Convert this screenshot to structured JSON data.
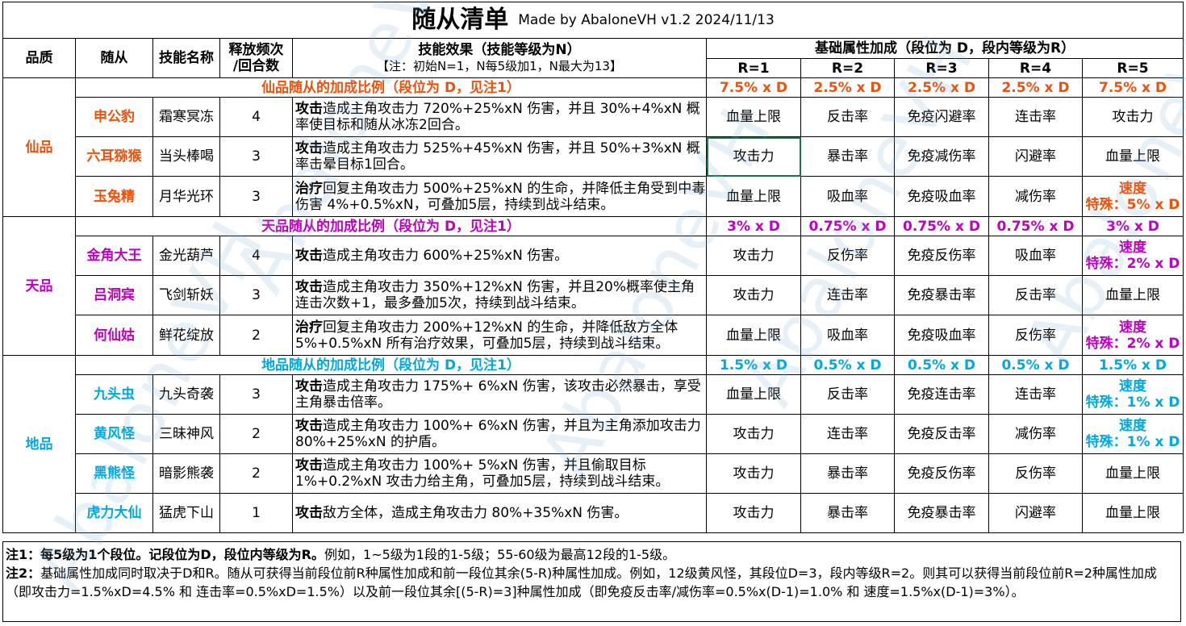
{
  "title": {
    "main": "随从清单",
    "sub": "Made by AbaloneVH  v1.2  2024/11/13"
  },
  "headers": {
    "quality": "品质",
    "follower": "随从",
    "skill_name": "技能名称",
    "freq_line1": "释放频次",
    "freq_line2": "/回合数",
    "effect_line1": "技能效果（技能等级为N）",
    "effect_line2": "【注：初始N=1，N每5级加1，N最大为13】",
    "attr_group": "基础属性加成（段位为 D，段内等级为R）",
    "r_labels": [
      "R=1",
      "R=2",
      "R=3",
      "R=4",
      "R=5"
    ]
  },
  "tiers": [
    {
      "quality": "仙品",
      "ratio_label": "仙品随从的加成比例（段位为 D，见注1）",
      "ratios": [
        "7.5% x D",
        "2.5% x D",
        "2.5% x D",
        "2.5% x D",
        "7.5% x D"
      ],
      "followers": [
        {
          "name": "申公豹",
          "skill": "霜寒冥冻",
          "freq": "4",
          "effect_bold": "攻击",
          "effect_rest": "造成主角攻击力 720%+25%xN 伤害，并且 30%+4%xN 概率使目标和随从冰冻2回合。",
          "attrs": [
            "血量上限",
            "反击率",
            "免疫闪避率",
            "连击率",
            "攻击力"
          ]
        },
        {
          "name": "六耳猕猴",
          "skill": "当头棒喝",
          "freq": "3",
          "effect_bold": "攻击",
          "effect_rest": "造成主角攻击力 525%+45%xN 伤害，并且 50%+3%xN 概率击晕目标1回合。",
          "attrs": [
            "攻击力",
            "暴击率",
            "免疫减伤率",
            "闪避率",
            "血量上限"
          ]
        },
        {
          "name": "玉兔精",
          "skill": "月华光环",
          "freq": "3",
          "effect_bold": "治疗",
          "effect_rest": "回复主角攻击力 500%+25%xN 的生命，并降低主角受到中毒伤害 4%+0.5%xN，可叠加5层，持续到战斗结束。",
          "attrs": [
            "血量上限",
            "吸血率",
            "免疫吸血率",
            "减伤率"
          ],
          "special_line1": "速度",
          "special_line2": "特殊：5% x D"
        }
      ]
    },
    {
      "quality": "天品",
      "ratio_label": "天品随从的加成比例（段位为 D，见注1）",
      "ratios": [
        "3% x D",
        "0.75% x D",
        "0.75% x D",
        "0.75% x D",
        "3% x D"
      ],
      "followers": [
        {
          "name": "金角大王",
          "skill": "金光葫芦",
          "freq": "4",
          "effect_bold": "攻击",
          "effect_rest": "造成主角攻击力 600%+25%xN 伤害。",
          "attrs": [
            "攻击力",
            "反伤率",
            "免疫反伤率",
            "吸血率"
          ],
          "special_line1": "速度",
          "special_line2": "特殊：2% x D"
        },
        {
          "name": "吕洞宾",
          "skill": "飞剑斩妖",
          "freq": "3",
          "effect_bold": "攻击",
          "effect_rest": "造成主角攻击力 350%+12%xN 伤害，并且20%概率使主角连击次数+1，最多叠加5次，持续到战斗结束。",
          "attrs": [
            "攻击力",
            "连击率",
            "免疫暴击率",
            "反击率",
            "血量上限"
          ]
        },
        {
          "name": "何仙姑",
          "skill": "鲜花绽放",
          "freq": "2",
          "effect_bold": "治疗",
          "effect_rest": "回复主角攻击力 200%+12%xN 的生命，并降低敌方全体 5%+0.5%xN 所有治疗效果，可叠加5层，持续到战斗结束。",
          "attrs": [
            "血量上限",
            "吸血率",
            "免疫吸血率",
            "反伤率"
          ],
          "special_line1": "速度",
          "special_line2": "特殊：2% x D"
        }
      ]
    },
    {
      "quality": "地品",
      "ratio_label": "地品随从的加成比例（段位为 D，见注1）",
      "ratios": [
        "1.5% x D",
        "0.5% x D",
        "0.5% x D",
        "0.5% x D",
        "1.5% x D"
      ],
      "followers": [
        {
          "name": "九头虫",
          "skill": "九头奇袭",
          "freq": "3",
          "effect_bold": "攻击",
          "effect_rest": "造成主角攻击力 175%+ 6%xN 伤害，该攻击必然暴击，享受主角暴击倍率。",
          "attrs": [
            "血量上限",
            "反击率",
            "免疫连击率",
            "连击率"
          ],
          "special_line1": "速度",
          "special_line2": "特殊：1% x D"
        },
        {
          "name": "黄风怪",
          "skill": "三昧神风",
          "freq": "2",
          "effect_bold": "攻击",
          "effect_rest": "造成主角攻击力 100%+ 6%xN 伤害，并且为主角添加攻击力 80%+25%xN 的护盾。",
          "attrs": [
            "攻击力",
            "连击率",
            "免疫反击率",
            "减伤率"
          ],
          "special_line1": "速度",
          "special_line2": "特殊：1% x D"
        },
        {
          "name": "黑熊怪",
          "skill": "暗影熊袭",
          "freq": "2",
          "effect_bold": "攻击",
          "effect_rest": "造成主角攻击力 100%+ 5%xN 伤害，并且偷取目标 1%+0.2%xN 攻击力给主角，可叠加5层，持续到战斗结束。",
          "attrs": [
            "攻击力",
            "暴击率",
            "免疫反伤率",
            "反伤率",
            "血量上限"
          ]
        },
        {
          "name": "虎力大仙",
          "skill": "猛虎下山",
          "freq": "1",
          "effect_bold": "攻击",
          "effect_rest": "敌方全体，造成主角攻击力 80%+35%xN 伤害。",
          "attrs": [
            "攻击力",
            "暴击率",
            "免疫暴击率",
            "闪避率",
            "血量上限"
          ]
        }
      ]
    }
  ],
  "notes": {
    "note1_bold": "注1：每5级为1个段位。记段位为D，段位内等级为R。",
    "note1_rest": "例如，1~5级为1段的1-5级；55-60级为最高12段的1-5级。",
    "note2_bold": "注2：",
    "note2_rest": "基础属性加成同时取决于D和R。随从可获得当前段位前R种属性加成和前一段位其余(5-R)种属性加成。例如，12级黄风怪，其段位D=3，段内等级R=2。则其可以获得当前段位前R=2种属性加成（即攻击力=1.5%xD=4.5% 和 连击率=0.5%xD=1.5%）以及前一段位其余[(5-R)=3]种属性加成（即免疫反击率/减伤率=0.5%x(D-1)=1.0% 和 速度=1.5%x(D-1)=3%）。"
  },
  "watermark": "AbaloneVH",
  "colors": {
    "xian": "#f0500a",
    "tian": "#c000c0",
    "di": "#00a8e0",
    "selection": "#1e7145"
  }
}
